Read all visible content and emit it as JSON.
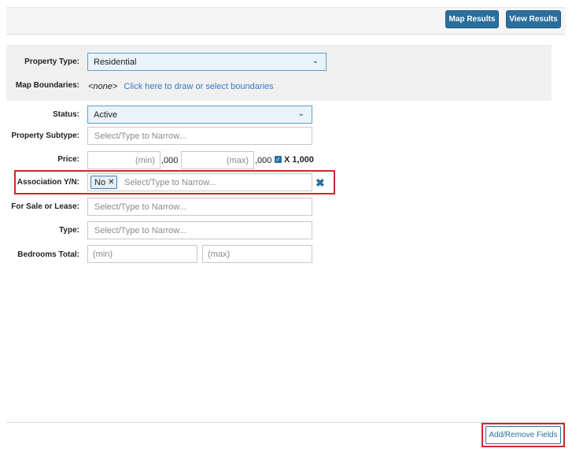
{
  "toolbar": {
    "map_results": "Map Results",
    "view_results": "View Results"
  },
  "form": {
    "property_type": {
      "label": "Property Type:",
      "value": "Residential"
    },
    "map_boundaries": {
      "label": "Map Boundaries:",
      "value": "<none>",
      "link": "Click here to draw or select boundaries"
    },
    "status": {
      "label": "Status:",
      "value": "Active"
    },
    "property_subtype": {
      "label": "Property Subtype:",
      "placeholder": "Select/Type to Narrow..."
    },
    "price": {
      "label": "Price:",
      "min_placeholder": "(min)",
      "max_placeholder": "(max)",
      "suffix_min": ",000",
      "suffix_max": ",000",
      "multiplier_label": "X 1,000",
      "multiplier_checked": true
    },
    "association": {
      "label": "Association Y/N:",
      "chip": "No",
      "placeholder": "Select/Type to Narrow..."
    },
    "for_sale_or_lease": {
      "label": "For Sale or Lease:",
      "placeholder": "Select/Type to Narrow..."
    },
    "type": {
      "label": "Type:",
      "placeholder": "Select/Type to Narrow..."
    },
    "bedrooms_total": {
      "label": "Bedrooms Total:",
      "min_placeholder": "(min)",
      "max_placeholder": "(max)"
    }
  },
  "footer": {
    "add_remove": "Add/Remove Fields"
  },
  "colors": {
    "primary": "#2a6f9e",
    "highlight": "#d0282a",
    "link": "#3a7bbf"
  }
}
